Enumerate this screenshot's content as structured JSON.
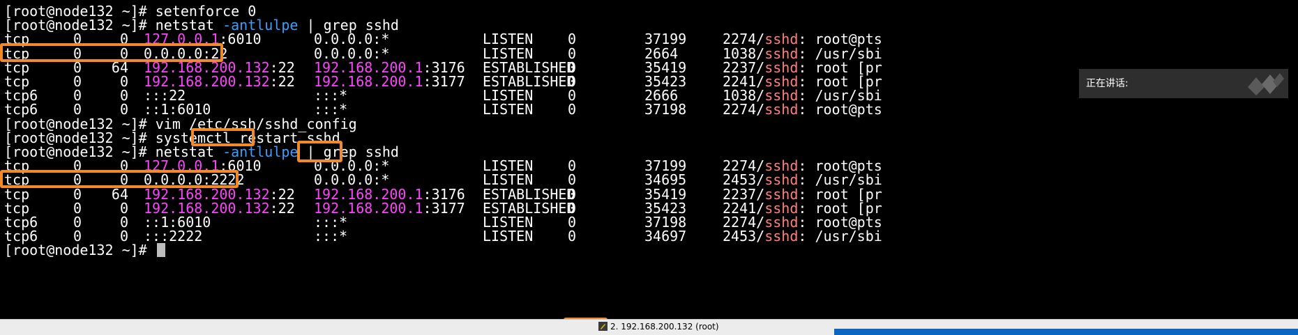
{
  "terminal": {
    "lines": [
      {
        "segments": [
          {
            "t": "[root@node132 ~]# setenforce 0"
          }
        ]
      },
      {
        "segments": [
          {
            "t": "[root@node132 ~]# netstat "
          },
          {
            "t": "-antlulpe",
            "c": "cy"
          },
          {
            "t": " | grep sshd"
          }
        ]
      },
      {
        "proto": "tcp",
        "recvq": "0",
        "sendq": "0",
        "local": [
          {
            "t": "127.0.0.1",
            "c": "mag"
          },
          {
            "t": ":6010"
          }
        ],
        "foreign": [
          {
            "t": "0.0.0.0:*"
          }
        ],
        "state": "LISTEN",
        "user": "0",
        "inode": "37199",
        "pid": [
          {
            "t": "2274/"
          },
          {
            "t": "sshd",
            "c": "sal"
          },
          {
            "t": ": root@pts"
          }
        ]
      },
      {
        "proto": "tcp",
        "recvq": "0",
        "sendq": "0",
        "local": [
          {
            "t": "0.0.0.0:22"
          }
        ],
        "foreign": [
          {
            "t": "0.0.0.0:*"
          }
        ],
        "state": "LISTEN",
        "user": "0",
        "inode": "2664",
        "pid": [
          {
            "t": "1038/"
          },
          {
            "t": "sshd",
            "c": "sal"
          },
          {
            "t": ": /usr/sbi"
          }
        ]
      },
      {
        "proto": "tcp",
        "recvq": "0",
        "sendq": "64",
        "local": [
          {
            "t": "192.168.200.132",
            "c": "mag"
          },
          {
            "t": ":22"
          }
        ],
        "foreign": [
          {
            "t": "192.168.200.1",
            "c": "mag"
          },
          {
            "t": ":3176"
          }
        ],
        "state": "ESTABLISHED",
        "user": "0",
        "inode": "35419",
        "pid": [
          {
            "t": "2237/"
          },
          {
            "t": "sshd",
            "c": "sal"
          },
          {
            "t": ": root [pr"
          }
        ]
      },
      {
        "proto": "tcp",
        "recvq": "0",
        "sendq": "0",
        "local": [
          {
            "t": "192.168.200.132",
            "c": "mag"
          },
          {
            "t": ":22"
          }
        ],
        "foreign": [
          {
            "t": "192.168.200.1",
            "c": "mag"
          },
          {
            "t": ":3177"
          }
        ],
        "state": "ESTABLISHED",
        "user": "0",
        "inode": "35423",
        "pid": [
          {
            "t": "2241/"
          },
          {
            "t": "sshd",
            "c": "sal"
          },
          {
            "t": ": root [pr"
          }
        ]
      },
      {
        "proto": "tcp6",
        "recvq": "0",
        "sendq": "0",
        "local": [
          {
            "t": ":::22"
          }
        ],
        "foreign": [
          {
            "t": ":::*"
          }
        ],
        "state": "LISTEN",
        "user": "0",
        "inode": "2666",
        "pid": [
          {
            "t": "1038/"
          },
          {
            "t": "sshd",
            "c": "sal"
          },
          {
            "t": ": /usr/sbi"
          }
        ]
      },
      {
        "proto": "tcp6",
        "recvq": "0",
        "sendq": "0",
        "local": [
          {
            "t": "::1:6010"
          }
        ],
        "foreign": [
          {
            "t": ":::*"
          }
        ],
        "state": "LISTEN",
        "user": "0",
        "inode": "37198",
        "pid": [
          {
            "t": "2274/"
          },
          {
            "t": "sshd",
            "c": "sal"
          },
          {
            "t": ": root@pts"
          }
        ]
      },
      {
        "segments": [
          {
            "t": "[root@node132 ~]# vim /etc/ssh/sshd_config"
          }
        ]
      },
      {
        "segments": [
          {
            "t": "[root@node132 ~]# systemctl restart sshd"
          }
        ]
      },
      {
        "segments": [
          {
            "t": "[root@node132 ~]# netstat "
          },
          {
            "t": "-antlulpe",
            "c": "cy"
          },
          {
            "t": " | grep sshd"
          }
        ]
      },
      {
        "proto": "tcp",
        "recvq": "0",
        "sendq": "0",
        "local": [
          {
            "t": "127.0.0.1",
            "c": "mag"
          },
          {
            "t": ":6010"
          }
        ],
        "foreign": [
          {
            "t": "0.0.0.0:*"
          }
        ],
        "state": "LISTEN",
        "user": "0",
        "inode": "37199",
        "pid": [
          {
            "t": "2274/"
          },
          {
            "t": "sshd",
            "c": "sal"
          },
          {
            "t": ": root@pts"
          }
        ]
      },
      {
        "proto": "tcp",
        "recvq": "0",
        "sendq": "0",
        "local": [
          {
            "t": "0.0.0.0:2222"
          }
        ],
        "foreign": [
          {
            "t": "0.0.0.0:*"
          }
        ],
        "state": "LISTEN",
        "user": "0",
        "inode": "34695",
        "pid": [
          {
            "t": "2453/"
          },
          {
            "t": "sshd",
            "c": "sal"
          },
          {
            "t": ": /usr/sbi"
          }
        ]
      },
      {
        "proto": "tcp",
        "recvq": "0",
        "sendq": "64",
        "local": [
          {
            "t": "192.168.200.132",
            "c": "mag"
          },
          {
            "t": ":22"
          }
        ],
        "foreign": [
          {
            "t": "192.168.200.1",
            "c": "mag"
          },
          {
            "t": ":3176"
          }
        ],
        "state": "ESTABLISHED",
        "user": "0",
        "inode": "35419",
        "pid": [
          {
            "t": "2237/"
          },
          {
            "t": "sshd",
            "c": "sal"
          },
          {
            "t": ": root [pr"
          }
        ]
      },
      {
        "proto": "tcp",
        "recvq": "0",
        "sendq": "0",
        "local": [
          {
            "t": "192.168.200.132",
            "c": "mag"
          },
          {
            "t": ":22"
          }
        ],
        "foreign": [
          {
            "t": "192.168.200.1",
            "c": "mag"
          },
          {
            "t": ":3177"
          }
        ],
        "state": "ESTABLISHED",
        "user": "0",
        "inode": "35423",
        "pid": [
          {
            "t": "2241/"
          },
          {
            "t": "sshd",
            "c": "sal"
          },
          {
            "t": ": root [pr"
          }
        ]
      },
      {
        "proto": "tcp6",
        "recvq": "0",
        "sendq": "0",
        "local": [
          {
            "t": "::1:6010"
          }
        ],
        "foreign": [
          {
            "t": ":::*"
          }
        ],
        "state": "LISTEN",
        "user": "0",
        "inode": "37198",
        "pid": [
          {
            "t": "2274/"
          },
          {
            "t": "sshd",
            "c": "sal"
          },
          {
            "t": ": root@pts"
          }
        ]
      },
      {
        "proto": "tcp6",
        "recvq": "0",
        "sendq": "0",
        "local": [
          {
            "t": ":::2222"
          }
        ],
        "foreign": [
          {
            "t": ":::*"
          }
        ],
        "state": "LISTEN",
        "user": "0",
        "inode": "34697",
        "pid": [
          {
            "t": "2453/"
          },
          {
            "t": "sshd",
            "c": "sal"
          },
          {
            "t": ": /usr/sbi"
          }
        ]
      },
      {
        "segments": [
          {
            "t": "[root@node132 ~]# "
          }
        ],
        "cursor": true
      }
    ]
  },
  "speaking_panel": {
    "label": "正在讲话:",
    "icon": "logo-icon"
  },
  "statusbar": {
    "session_label": "2. 192.168.200.132 (root)",
    "icon": "pin-icon"
  },
  "colors": {
    "highlight": "#f08a2a",
    "ip": "#ff44ff",
    "process": "#ff8080",
    "option": "#3aa0ff",
    "progress": "#0a66c2"
  }
}
